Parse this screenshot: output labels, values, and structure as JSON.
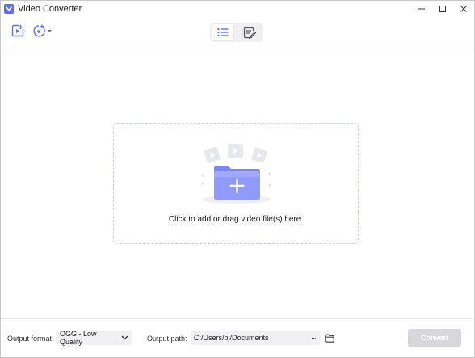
{
  "window": {
    "title": "Video Converter"
  },
  "toolbar": {
    "add_files_icon": "add-file-icon",
    "add_dvd_icon": "add-disc-icon",
    "view_list_icon": "list-view-icon",
    "view_edit_icon": "edit-list-icon"
  },
  "dropzone": {
    "hint": "Click to add or drag video file(s) here."
  },
  "bottom": {
    "format_label": "Output format:",
    "format_value": "OGG - Low Quality",
    "path_label": "Output path:",
    "path_value": "C:/Users/bj/Documents",
    "path_more": "···",
    "convert_label": "Convert"
  },
  "colors": {
    "accent": "#5b6ef5",
    "folder_light": "#a9b2ff",
    "folder_dark": "#7a86f7",
    "dashed_border": "#c9cdf2",
    "convert_disabled": "#d8d8dc"
  }
}
